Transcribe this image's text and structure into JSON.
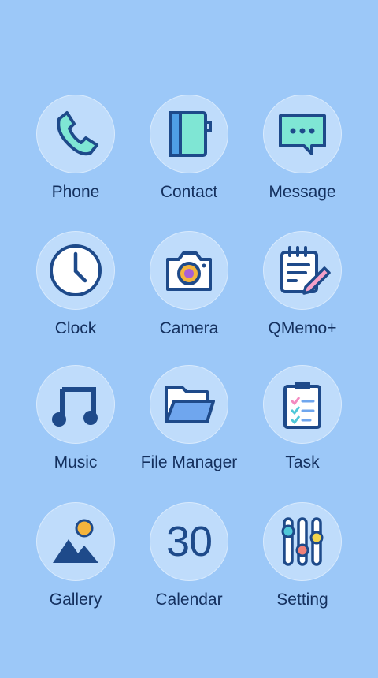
{
  "colors": {
    "background": "#9cc8f8",
    "icon_circle": "#bfdcfb",
    "icon_stroke": "#1e4a8a",
    "accent_teal": "#7fe6d4",
    "label_text": "#14305e"
  },
  "apps": [
    {
      "label": "Phone",
      "icon": "phone-icon"
    },
    {
      "label": "Contact",
      "icon": "contact-book-icon"
    },
    {
      "label": "Message",
      "icon": "message-bubble-icon"
    },
    {
      "label": "Clock",
      "icon": "clock-icon"
    },
    {
      "label": "Camera",
      "icon": "camera-icon"
    },
    {
      "label": "QMemo+",
      "icon": "memo-pencil-icon"
    },
    {
      "label": "Music",
      "icon": "music-note-icon"
    },
    {
      "label": "File Manager",
      "icon": "folder-icon"
    },
    {
      "label": "Task",
      "icon": "clipboard-checklist-icon"
    },
    {
      "label": "Gallery",
      "icon": "picture-mountain-icon"
    },
    {
      "label": "Calendar",
      "icon": "calendar-date-icon",
      "icon_text": "30"
    },
    {
      "label": "Setting",
      "icon": "sliders-icon"
    }
  ]
}
